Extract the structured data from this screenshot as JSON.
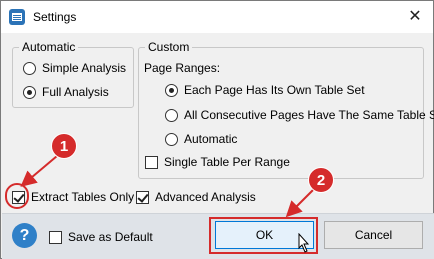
{
  "window": {
    "title": "Settings",
    "close_glyph": "✕"
  },
  "automatic": {
    "legend": "Automatic",
    "options": [
      {
        "label": "Simple Analysis",
        "selected": false
      },
      {
        "label": "Full Analysis",
        "selected": true
      }
    ]
  },
  "custom": {
    "legend": "Custom",
    "page_ranges_label": "Page Ranges:",
    "options": [
      {
        "label": "Each Page Has Its Own Table Set",
        "selected": true
      },
      {
        "label": "All Consecutive Pages Have The Same Table Set",
        "selected": false
      },
      {
        "label": "Automatic",
        "selected": false
      }
    ],
    "single_table_label": "Single Table Per Range",
    "single_table_checked": false
  },
  "options": {
    "extract_tables_label": "Extract Tables Only",
    "extract_tables_checked": true,
    "advanced_label": "Advanced Analysis",
    "advanced_checked": true
  },
  "footer": {
    "help_glyph": "?",
    "save_default_label": "Save as Default",
    "save_default_checked": false,
    "ok_label": "OK",
    "cancel_label": "Cancel"
  },
  "annotations": {
    "badge1": "1",
    "badge2": "2",
    "color": "#d52b2b"
  }
}
